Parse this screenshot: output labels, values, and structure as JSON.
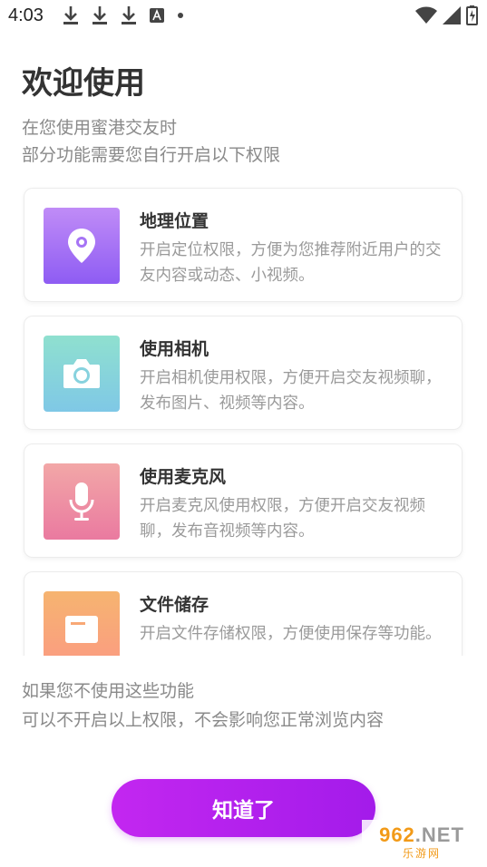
{
  "status_bar": {
    "time": "4:03",
    "left_icons": [
      "download-icon",
      "download-icon",
      "download-icon",
      "font-icon",
      "dot-icon"
    ],
    "right_icons": [
      "wifi-icon",
      "signal-icon",
      "battery-charging-icon"
    ]
  },
  "header": {
    "title": "欢迎使用",
    "intro_line1": "在您使用蜜港交友时",
    "intro_line2": "部分功能需要您自行开启以下权限"
  },
  "permissions": [
    {
      "title": "地理位置",
      "desc": "开启定位权限，方便为您推荐附近用户的交友内容或动态、小视频。",
      "icon": "location-pin-icon",
      "gradient": [
        "#c08cf7",
        "#8e5cf3"
      ]
    },
    {
      "title": "使用相机",
      "desc": "开启相机使用权限，方便开启交友视频聊，发布图片、视频等内容。",
      "icon": "camera-icon",
      "gradient": [
        "#8fe0cf",
        "#7fc8e6"
      ]
    },
    {
      "title": "使用麦克风",
      "desc": "开启麦克风使用权限，方便开启交友视频聊，发布音视频等内容。",
      "icon": "microphone-icon",
      "gradient": [
        "#f2a7a7",
        "#ea7aa0"
      ]
    },
    {
      "title": "文件储存",
      "desc": "开启文件存储权限，方便使用保存等功能。",
      "icon": "folder-icon",
      "gradient": [
        "#f6b470",
        "#fb9b82"
      ]
    }
  ],
  "footer": {
    "note_line1": "如果您不使用这些功能",
    "note_line2": "可以不开启以上权限，不会影响您正常浏览内容"
  },
  "confirm_label": "知道了",
  "watermark": {
    "main_digits": "962",
    "main_suffix": ".NET",
    "sub": "乐游网"
  }
}
